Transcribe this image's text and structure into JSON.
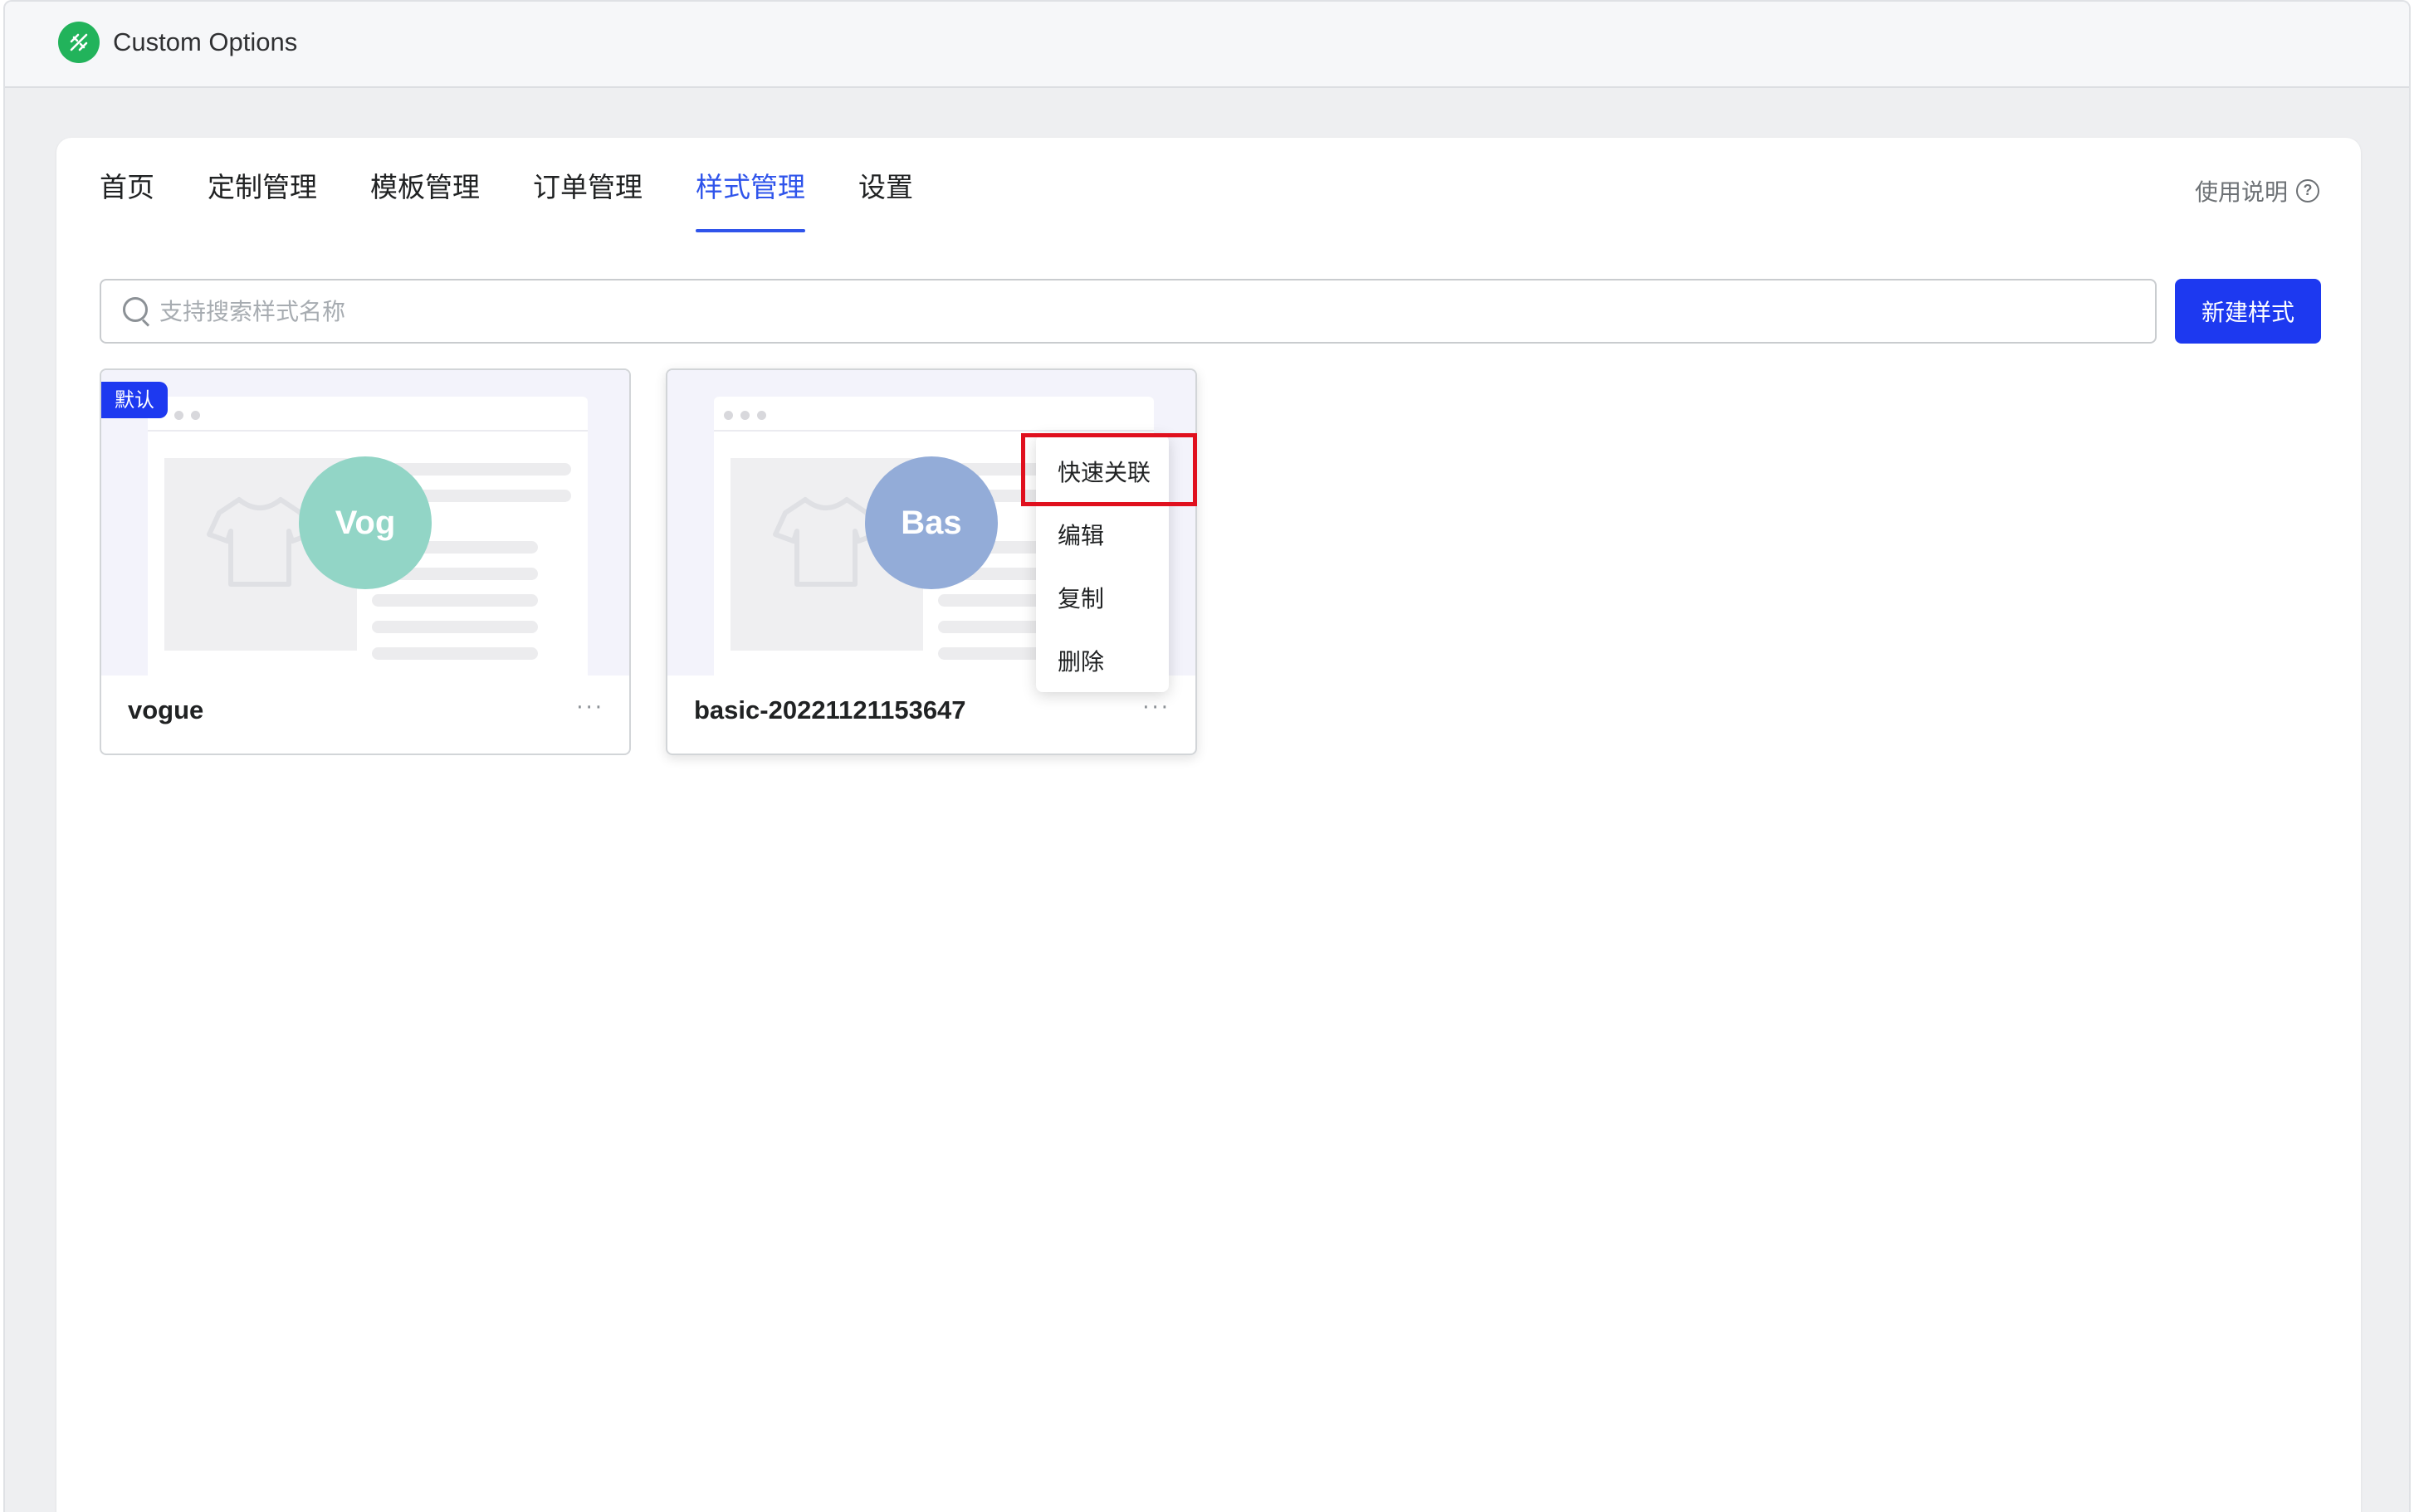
{
  "app": {
    "title": "Custom Options"
  },
  "nav": {
    "tabs": [
      {
        "label": "首页",
        "active": false
      },
      {
        "label": "定制管理",
        "active": false
      },
      {
        "label": "模板管理",
        "active": false
      },
      {
        "label": "订单管理",
        "active": false
      },
      {
        "label": "样式管理",
        "active": true
      },
      {
        "label": "设置",
        "active": false
      }
    ],
    "help_label": "使用说明",
    "help_icon": "question-circle-icon"
  },
  "search": {
    "placeholder": "支持搜索样式名称",
    "value": ""
  },
  "toolbar": {
    "new_button_label": "新建样式"
  },
  "cards": [
    {
      "name": "vogue",
      "badge": "默认",
      "initials": "Vog",
      "color": "#92d5c6"
    },
    {
      "name": "basic-20221121153647",
      "badge": "",
      "initials": "Bas",
      "color": "#93acd8"
    }
  ],
  "context_menu": {
    "items": [
      {
        "label": "快速关联"
      },
      {
        "label": "编辑"
      },
      {
        "label": "复制"
      },
      {
        "label": "删除"
      }
    ]
  },
  "colors": {
    "accent": "#1d39f0",
    "active_tab": "#2f54eb",
    "logo_green": "#22b35b",
    "highlight_red": "#e0101e"
  }
}
